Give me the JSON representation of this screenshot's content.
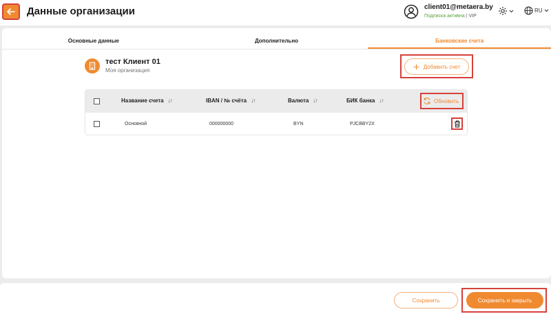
{
  "header": {
    "title": "Данные организации",
    "user_email": "client01@metaera.by",
    "subscription_status": "Подписка активна",
    "separator": "|",
    "plan": "VIP",
    "language": "RU"
  },
  "tabs": [
    {
      "label": "Основные данные",
      "active": false
    },
    {
      "label": "Дополнительно",
      "active": false
    },
    {
      "label": "Банковские счета",
      "active": true
    }
  ],
  "organization": {
    "name": "тест Клиент 01",
    "subtitle": "Моя организация"
  },
  "actions": {
    "add_account_label": "Добавить счет",
    "refresh_label": "Обновить"
  },
  "table": {
    "columns": [
      {
        "label": "Название счета",
        "sort": "↓↑"
      },
      {
        "label": "IBAN / № счёта",
        "sort": "↓↑"
      },
      {
        "label": "Валюта",
        "sort": "↓↑"
      },
      {
        "label": "БИК банка",
        "sort": "↓↑"
      }
    ],
    "rows": [
      {
        "name": "Основной",
        "iban": "000000000",
        "currency": "BYN",
        "bic": "PJCBBY2X"
      }
    ]
  },
  "footer": {
    "save_label": "Сохранить",
    "save_close_label": "Сохранить и закрыть"
  },
  "colors": {
    "accent": "#f08a30",
    "highlight": "#d6403a",
    "active_green": "#5aa23a"
  }
}
